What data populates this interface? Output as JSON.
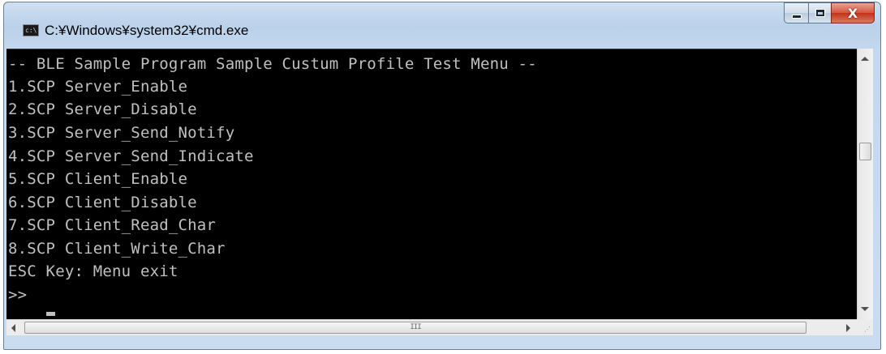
{
  "window": {
    "title": "C:¥Windows¥system32¥cmd.exe",
    "icon": "cmd-console-icon",
    "icon_text": "c:\\"
  },
  "caption_buttons": {
    "minimize_icon": "minimize-icon",
    "maximize_icon": "maximize-icon",
    "close_icon": "close-icon",
    "close_glyph": "X"
  },
  "console": {
    "background": "#000000",
    "foreground": "#c0c0c0",
    "lines": [
      "-- BLE Sample Program Sample Custum Profile Test Menu --",
      "1.SCP Server_Enable",
      "2.SCP Server_Disable",
      "3.SCP Server_Send_Notify",
      "4.SCP Server_Send_Indicate",
      "5.SCP Client_Enable",
      "6.SCP Client_Disable",
      "7.SCP Client_Read_Char",
      "8.SCP Client_Write_Char",
      "ESC Key: Menu exit",
      ">>"
    ]
  },
  "scrollbars": {
    "vertical_up_icon": "scroll-up-arrow-icon",
    "vertical_down_icon": "scroll-down-arrow-icon",
    "horizontal_left_icon": "scroll-left-arrow-icon",
    "horizontal_right_icon": "scroll-right-arrow-icon",
    "grip": "III"
  }
}
